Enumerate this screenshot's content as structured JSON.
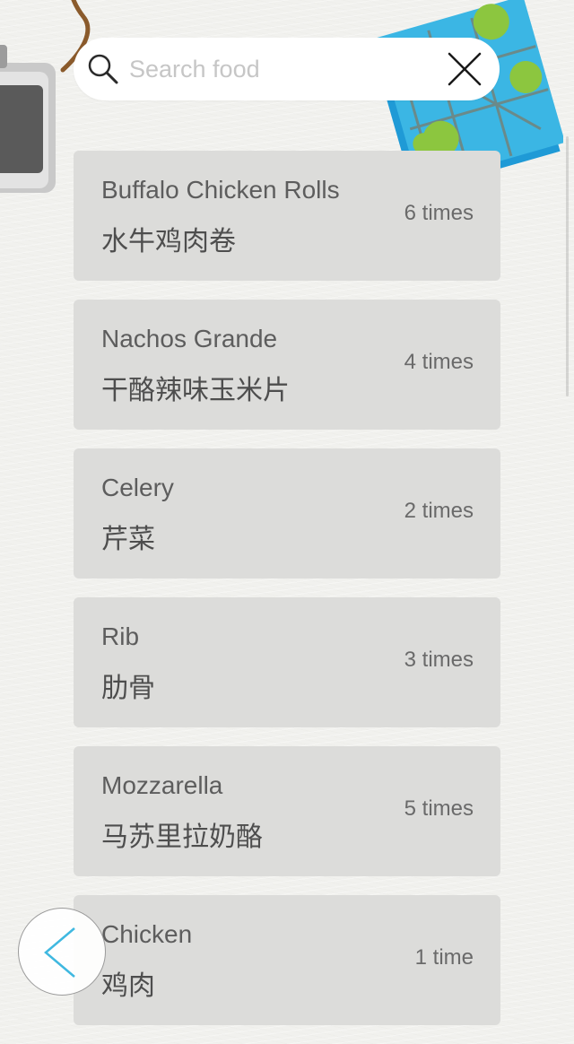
{
  "search": {
    "placeholder": "Search food",
    "value": ""
  },
  "foods": [
    {
      "name_en": "Buffalo Chicken Rolls",
      "name_zh": "水牛鸡肉卷",
      "count": "6 times"
    },
    {
      "name_en": "Nachos Grande",
      "name_zh": "干酪辣味玉米片",
      "count": "4 times"
    },
    {
      "name_en": "Celery",
      "name_zh": "芹菜",
      "count": "2 times"
    },
    {
      "name_en": "Rib",
      "name_zh": "肋骨",
      "count": "3 times"
    },
    {
      "name_en": "Mozzarella",
      "name_zh": "马苏里拉奶酪",
      "count": "5 times"
    },
    {
      "name_en": "Chicken",
      "name_zh": "鸡肉",
      "count": "1 time"
    }
  ],
  "icons": {
    "search": "search-icon",
    "clear": "close-icon",
    "back": "chevron-left-icon"
  },
  "colors": {
    "background": "#f1f1ee",
    "card": "#dcdcda",
    "accent": "#3fb8e0"
  }
}
